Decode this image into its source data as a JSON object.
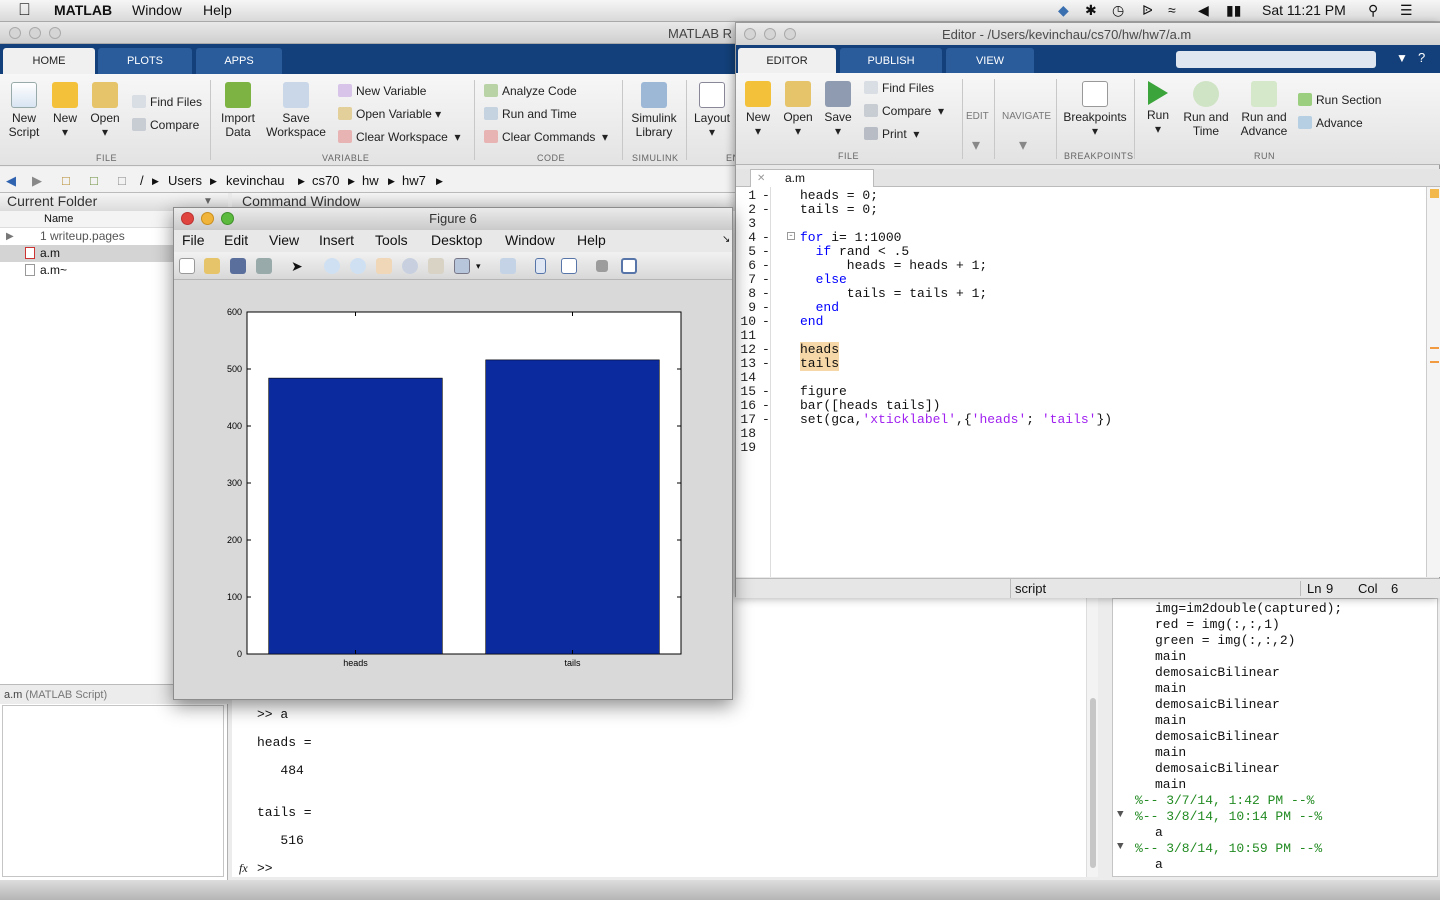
{
  "menubar": {
    "app_name": "MATLAB",
    "items": [
      "Window",
      "Help"
    ],
    "clock": "Sat 11:21 PM"
  },
  "main_window": {
    "title": "MATLAB R",
    "tabs": [
      "HOME",
      "PLOTS",
      "APPS"
    ],
    "ribbon": {
      "new_script": "New\nScript",
      "new": "New",
      "open": "Open",
      "find_files": "Find Files",
      "compare": "Compare",
      "import_data": "Import\nData",
      "save_workspace": "Save\nWorkspace",
      "new_variable": "New Variable",
      "open_variable": "Open Variable",
      "clear_workspace": "Clear Workspace",
      "analyze_code": "Analyze Code",
      "run_and_time": "Run and Time",
      "clear_commands": "Clear Commands",
      "simulink_library": "Simulink\nLibrary",
      "layout": "Layout",
      "groups": [
        "FILE",
        "VARIABLE",
        "CODE",
        "SIMULINK",
        "EN"
      ]
    },
    "address": [
      "/",
      "Users",
      "kevinchau",
      "cs70",
      "hw",
      "hw7"
    ]
  },
  "current_folder": {
    "title": "Current Folder",
    "column": "Name",
    "files": [
      "1 writeup.pages",
      "a.m",
      "a.m~"
    ],
    "detail": "a.m",
    "detail_type": "(MATLAB Script)"
  },
  "command_window": {
    "title": "Command Window",
    "lines": [
      ">> a",
      "heads =",
      "   484",
      "tails =",
      "   516",
      ">>"
    ],
    "fx": "fx"
  },
  "history": {
    "lines": [
      "img=im2double(captured);",
      "red = img(:,:,1)",
      "green = img(:,:,2)",
      "main",
      "demosaicBilinear",
      "main",
      "demosaicBilinear",
      "main",
      "demosaicBilinear",
      "main",
      "demosaicBilinear",
      "main",
      "%-- 3/7/14, 1:42 PM --%",
      "%-- 3/8/14, 10:14 PM --%",
      "a",
      "%-- 3/8/14, 10:59 PM --%",
      "a"
    ]
  },
  "editor": {
    "title": "Editor - /Users/kevinchau/cs70/hw/hw7/a.m",
    "tabs": [
      "EDITOR",
      "PUBLISH",
      "VIEW"
    ],
    "ribbon": {
      "new": "New",
      "open": "Open",
      "save": "Save",
      "find_files": "Find Files",
      "compare": "Compare",
      "print": "Print",
      "edit": "EDIT",
      "navigate": "NAVIGATE",
      "breakpoints": "Breakpoints",
      "run": "Run",
      "run_and_time": "Run and\nTime",
      "run_and_advance": "Run and\nAdvance",
      "run_section": "Run Section",
      "advance": "Advance",
      "groups": [
        "FILE",
        "BREAKPOINTS",
        "RUN"
      ]
    },
    "file_tab": "a.m",
    "code_lines": [
      "heads = 0;",
      "tails = 0;",
      "",
      "for i= 1:1000",
      "  if rand < .5",
      "      heads = heads + 1;",
      "  else",
      "      tails = tails + 1;",
      "  end",
      "end",
      "",
      "heads",
      "tails",
      "",
      "figure",
      "bar([heads tails])",
      "set(gca,'xticklabel',{'heads'; 'tails'})",
      "",
      ""
    ],
    "status": {
      "mode": "script",
      "ln_label": "Ln",
      "ln": "9",
      "col_label": "Col",
      "col": "6"
    }
  },
  "figure": {
    "title": "Figure 6",
    "menu": [
      "File",
      "Edit",
      "View",
      "Insert",
      "Tools",
      "Desktop",
      "Window",
      "Help"
    ]
  },
  "chart_data": {
    "type": "bar",
    "categories": [
      "heads",
      "tails"
    ],
    "values": [
      484,
      516
    ],
    "ylim": [
      0,
      600
    ],
    "yticks": [
      "0",
      "100",
      "200",
      "300",
      "400",
      "500",
      "600"
    ],
    "bar_color": "#0b2a9e",
    "grid": false
  }
}
